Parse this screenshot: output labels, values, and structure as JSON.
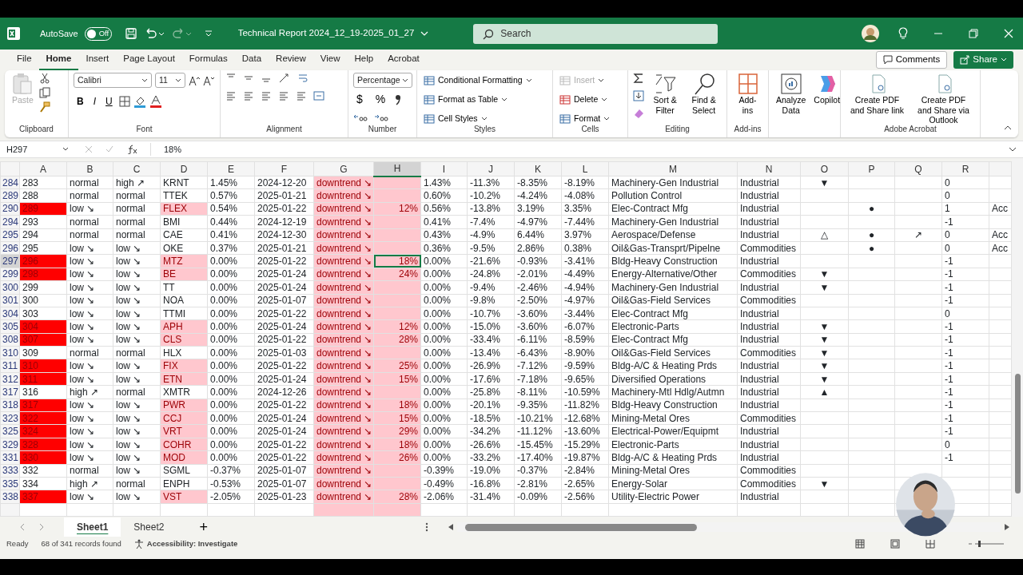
{
  "titlebar": {
    "autosave_label": "AutoSave",
    "autosave": {
      "on": false,
      "text": "Off"
    },
    "title": "Technical Report 2024_12_19-2025_01_27",
    "search": {
      "placeholder": "Search"
    }
  },
  "menu": [
    {
      "label": "File",
      "selected": false
    },
    {
      "label": "Home",
      "selected": true
    },
    {
      "label": "Insert",
      "selected": false
    },
    {
      "label": "Page Layout",
      "selected": false
    },
    {
      "label": "Formulas",
      "selected": false
    },
    {
      "label": "Data",
      "selected": false
    },
    {
      "label": "Review",
      "selected": false
    },
    {
      "label": "View",
      "selected": false
    },
    {
      "label": "Help",
      "selected": false
    },
    {
      "label": "Acrobat",
      "selected": false
    }
  ],
  "menu_buttons": [
    "Comments",
    "Share"
  ],
  "ribbon": [
    {
      "label": "Clipboard",
      "items": [
        {
          "kind": "paste",
          "text": "Paste",
          "disabled": true
        }
      ]
    },
    {
      "label": "Font",
      "items": [
        {
          "kind": "select",
          "text": "Calibri",
          "disabled": false
        },
        {
          "kind": "select",
          "text": "11",
          "disabled": false
        },
        {
          "kind": "glyph",
          "text": "B",
          "disabled": false
        },
        {
          "kind": "glyph",
          "text": "I",
          "disabled": false
        },
        {
          "kind": "glyph",
          "text": "U",
          "disabled": false
        }
      ]
    },
    {
      "label": "Alignment"
    },
    {
      "label": "Number",
      "items": [
        {
          "kind": "select",
          "text": "Percentage",
          "disabled": false
        },
        {
          "kind": "glyph",
          "text": "$",
          "disabled": false
        },
        {
          "kind": "glyph",
          "text": "%",
          "disabled": false
        }
      ]
    },
    {
      "label": "Styles",
      "items": [
        {
          "kind": "small",
          "text": "Conditional Formatting",
          "disabled": false
        },
        {
          "kind": "small",
          "text": "Format as Table",
          "disabled": false
        },
        {
          "kind": "small",
          "text": "Cell Styles",
          "disabled": false
        }
      ]
    },
    {
      "label": "Cells",
      "items": [
        {
          "kind": "small",
          "text": "Insert",
          "disabled": true
        },
        {
          "kind": "small",
          "text": "Delete",
          "disabled": false
        },
        {
          "kind": "small",
          "text": "Format",
          "disabled": false
        }
      ]
    },
    {
      "label": "Editing",
      "items": [
        {
          "kind": "big",
          "text": "Sort & Filter",
          "disabled": false
        },
        {
          "kind": "big",
          "text": "Find & Select",
          "disabled": false
        }
      ]
    },
    {
      "label": "Add-ins",
      "items": [
        {
          "kind": "big",
          "text": "Add-ins",
          "disabled": false
        }
      ]
    },
    {
      "items": [
        {
          "kind": "big",
          "text": "Analyze Data",
          "disabled": false
        },
        {
          "kind": "big",
          "text": "Copilot",
          "disabled": false
        }
      ]
    },
    {
      "label": "Adobe Acrobat",
      "items": [
        {
          "kind": "big",
          "text": "Create PDF and Share link",
          "disabled": false
        },
        {
          "kind": "big",
          "text": "Create PDF and Share via Outlook",
          "disabled": false
        }
      ]
    }
  ],
  "formula_bar": {
    "name_box": "H297",
    "formula": "18%"
  },
  "columns": [
    {
      "letter": "A",
      "selected": false,
      "highlight": false
    },
    {
      "letter": "B",
      "selected": false,
      "highlight": false
    },
    {
      "letter": "C",
      "selected": false,
      "highlight": false
    },
    {
      "letter": "D",
      "selected": false,
      "highlight": false
    },
    {
      "letter": "E",
      "selected": false,
      "highlight": false
    },
    {
      "letter": "F",
      "selected": false,
      "highlight": false
    },
    {
      "letter": "G",
      "selected": false,
      "highlight": true
    },
    {
      "letter": "H",
      "selected": true,
      "highlight": true
    },
    {
      "letter": "I",
      "selected": false,
      "highlight": false
    },
    {
      "letter": "J",
      "selected": false,
      "highlight": false
    },
    {
      "letter": "K",
      "selected": false,
      "highlight": false
    },
    {
      "letter": "L",
      "selected": false,
      "highlight": false
    },
    {
      "letter": "M",
      "selected": false,
      "highlight": false
    },
    {
      "letter": "N",
      "selected": false,
      "highlight": false
    },
    {
      "letter": "O",
      "selected": false,
      "highlight": false
    },
    {
      "letter": "P",
      "selected": false,
      "highlight": false
    },
    {
      "letter": "Q",
      "selected": false,
      "highlight": false
    },
    {
      "letter": "R",
      "selected": false,
      "highlight": false
    }
  ],
  "rows": [
    {
      "row": "284",
      "flagged": false,
      "selected": false,
      "cells": [
        "283",
        "normal",
        "high ↗",
        "KRNT",
        "1.45%",
        "2024-12-20",
        "downtrend ↘",
        "",
        "1.43%",
        "-11.3%",
        "-8.35%",
        "-8.19%",
        "Machinery-Gen Industrial",
        "Industrial",
        "▼",
        "",
        "",
        "0",
        ""
      ]
    },
    {
      "row": "289",
      "flagged": false,
      "selected": false,
      "cells": [
        "288",
        "normal",
        "normal",
        "TTEK",
        "0.57%",
        "2025-01-21",
        "downtrend ↘",
        "",
        "0.60%",
        "-10.2%",
        "-4.24%",
        "-4.08%",
        "Pollution Control",
        "Industrial",
        "",
        "",
        "",
        "0",
        ""
      ]
    },
    {
      "row": "290",
      "flagged": true,
      "selected": false,
      "cells": [
        "289",
        "low ↘",
        "normal",
        "FLEX",
        "0.54%",
        "2025-01-22",
        "downtrend ↘",
        "12%",
        "0.56%",
        "-13.8%",
        "3.19%",
        "3.35%",
        "Elec-Contract Mfg",
        "Industrial",
        "",
        "●",
        "",
        "1",
        "Acc"
      ]
    },
    {
      "row": "294",
      "flagged": false,
      "selected": false,
      "cells": [
        "293",
        "normal",
        "normal",
        "BMI",
        "0.44%",
        "2024-12-19",
        "downtrend ↘",
        "",
        "0.41%",
        "-7.4%",
        "-4.97%",
        "-7.44%",
        "Machinery-Gen Industrial",
        "Industrial",
        "",
        "",
        "",
        "-1",
        ""
      ]
    },
    {
      "row": "295",
      "flagged": false,
      "selected": false,
      "cells": [
        "294",
        "normal",
        "normal",
        "CAE",
        "0.41%",
        "2024-12-30",
        "downtrend ↘",
        "",
        "0.43%",
        "-4.9%",
        "6.44%",
        "3.97%",
        "Aerospace/Defense",
        "Industrial",
        "△",
        "●",
        "↗",
        "0",
        "Acc"
      ]
    },
    {
      "row": "296",
      "flagged": false,
      "selected": false,
      "cells": [
        "295",
        "low ↘",
        "low ↘",
        "OKE",
        "0.37%",
        "2025-01-21",
        "downtrend ↘",
        "",
        "0.36%",
        "-9.5%",
        "2.86%",
        "0.38%",
        "Oil&Gas-Transprt/Pipelne",
        "Commodities",
        "",
        "●",
        "",
        "0",
        "Acc"
      ]
    },
    {
      "row": "297",
      "flagged": true,
      "selected": true,
      "cells": [
        "296",
        "low ↘",
        "low ↘",
        "MTZ",
        "0.00%",
        "2025-01-22",
        "downtrend ↘",
        "18%",
        "0.00%",
        "-21.6%",
        "-0.93%",
        "-3.41%",
        "Bldg-Heavy Construction",
        "Industrial",
        "",
        "",
        "",
        "-1",
        ""
      ]
    },
    {
      "row": "299",
      "flagged": true,
      "selected": false,
      "cells": [
        "298",
        "low ↘",
        "low ↘",
        "BE",
        "0.00%",
        "2025-01-24",
        "downtrend ↘",
        "24%",
        "0.00%",
        "-24.8%",
        "-2.01%",
        "-4.49%",
        "Energy-Alternative/Other",
        "Commodities",
        "▼",
        "",
        "",
        "-1",
        ""
      ]
    },
    {
      "row": "300",
      "flagged": false,
      "selected": false,
      "cells": [
        "299",
        "low ↘",
        "low ↘",
        "TT",
        "0.00%",
        "2025-01-24",
        "downtrend ↘",
        "",
        "0.00%",
        "-9.4%",
        "-2.46%",
        "-4.94%",
        "Machinery-Gen Industrial",
        "Industrial",
        "▼",
        "",
        "",
        "-1",
        ""
      ]
    },
    {
      "row": "301",
      "flagged": false,
      "selected": false,
      "cells": [
        "300",
        "low ↘",
        "low ↘",
        "NOA",
        "0.00%",
        "2025-01-07",
        "downtrend ↘",
        "",
        "0.00%",
        "-9.8%",
        "-2.50%",
        "-4.97%",
        "Oil&Gas-Field Services",
        "Commodities",
        "",
        "",
        "",
        "-1",
        ""
      ]
    },
    {
      "row": "304",
      "flagged": false,
      "selected": false,
      "cells": [
        "303",
        "low ↘",
        "low ↘",
        "TTMI",
        "0.00%",
        "2025-01-22",
        "downtrend ↘",
        "",
        "0.00%",
        "-10.7%",
        "-3.60%",
        "-3.44%",
        "Elec-Contract Mfg",
        "Industrial",
        "",
        "",
        "",
        "0",
        ""
      ]
    },
    {
      "row": "305",
      "flagged": true,
      "selected": false,
      "cells": [
        "304",
        "low ↘",
        "low ↘",
        "APH",
        "0.00%",
        "2025-01-24",
        "downtrend ↘",
        "12%",
        "0.00%",
        "-15.0%",
        "-3.60%",
        "-6.07%",
        "Electronic-Parts",
        "Industrial",
        "▼",
        "",
        "",
        "-1",
        ""
      ]
    },
    {
      "row": "308",
      "flagged": true,
      "selected": false,
      "cells": [
        "307",
        "low ↘",
        "low ↘",
        "CLS",
        "0.00%",
        "2025-01-22",
        "downtrend ↘",
        "28%",
        "0.00%",
        "-33.4%",
        "-6.11%",
        "-8.59%",
        "Elec-Contract Mfg",
        "Industrial",
        "▼",
        "",
        "",
        "-1",
        ""
      ]
    },
    {
      "row": "310",
      "flagged": false,
      "selected": false,
      "cells": [
        "309",
        "normal",
        "normal",
        "HLX",
        "0.00%",
        "2025-01-03",
        "downtrend ↘",
        "",
        "0.00%",
        "-13.4%",
        "-6.43%",
        "-8.90%",
        "Oil&Gas-Field Services",
        "Commodities",
        "▼",
        "",
        "",
        "-1",
        ""
      ]
    },
    {
      "row": "311",
      "flagged": true,
      "selected": false,
      "cells": [
        "310",
        "low ↘",
        "low ↘",
        "FIX",
        "0.00%",
        "2025-01-22",
        "downtrend ↘",
        "25%",
        "0.00%",
        "-26.9%",
        "-7.12%",
        "-9.59%",
        "Bldg-A/C & Heating Prds",
        "Industrial",
        "▼",
        "",
        "",
        "-1",
        ""
      ]
    },
    {
      "row": "312",
      "flagged": true,
      "selected": false,
      "cells": [
        "311",
        "low ↘",
        "low ↘",
        "ETN",
        "0.00%",
        "2025-01-24",
        "downtrend ↘",
        "15%",
        "0.00%",
        "-17.6%",
        "-7.18%",
        "-9.65%",
        "Diversified Operations",
        "Industrial",
        "▼",
        "",
        "",
        "-1",
        ""
      ]
    },
    {
      "row": "317",
      "flagged": false,
      "selected": false,
      "cells": [
        "316",
        "high ↗",
        "normal",
        "XMTR",
        "0.00%",
        "2024-12-26",
        "downtrend ↘",
        "",
        "0.00%",
        "-25.8%",
        "-8.11%",
        "-10.59%",
        "Machinery-Mtl Hdlg/Autmn",
        "Industrial",
        "▲",
        "",
        "",
        "-1",
        ""
      ]
    },
    {
      "row": "318",
      "flagged": true,
      "selected": false,
      "cells": [
        "317",
        "low ↘",
        "low ↘",
        "PWR",
        "0.00%",
        "2025-01-22",
        "downtrend ↘",
        "18%",
        "0.00%",
        "-20.1%",
        "-9.35%",
        "-11.82%",
        "Bldg-Heavy Construction",
        "Industrial",
        "",
        "",
        "",
        "-1",
        ""
      ]
    },
    {
      "row": "323",
      "flagged": true,
      "selected": false,
      "cells": [
        "322",
        "low ↘",
        "low ↘",
        "CCJ",
        "0.00%",
        "2025-01-24",
        "downtrend ↘",
        "15%",
        "0.00%",
        "-18.5%",
        "-10.21%",
        "-12.68%",
        "Mining-Metal Ores",
        "Commodities",
        "",
        "",
        "",
        "-1",
        ""
      ]
    },
    {
      "row": "325",
      "flagged": true,
      "selected": false,
      "cells": [
        "324",
        "low ↘",
        "low ↘",
        "VRT",
        "0.00%",
        "2025-01-24",
        "downtrend ↘",
        "29%",
        "0.00%",
        "-34.2%",
        "-11.12%",
        "-13.60%",
        "Electrical-Power/Equipmt",
        "Industrial",
        "",
        "",
        "",
        "-1",
        ""
      ]
    },
    {
      "row": "329",
      "flagged": true,
      "selected": false,
      "cells": [
        "328",
        "low ↘",
        "low ↘",
        "COHR",
        "0.00%",
        "2025-01-22",
        "downtrend ↘",
        "18%",
        "0.00%",
        "-26.6%",
        "-15.45%",
        "-15.29%",
        "Electronic-Parts",
        "Industrial",
        "",
        "",
        "",
        "0",
        ""
      ]
    },
    {
      "row": "331",
      "flagged": true,
      "selected": false,
      "cells": [
        "330",
        "low ↘",
        "low ↘",
        "MOD",
        "0.00%",
        "2025-01-22",
        "downtrend ↘",
        "26%",
        "0.00%",
        "-33.2%",
        "-17.40%",
        "-19.87%",
        "Bldg-A/C & Heating Prds",
        "Industrial",
        "",
        "",
        "",
        "-1",
        ""
      ]
    },
    {
      "row": "333",
      "flagged": false,
      "selected": false,
      "cells": [
        "332",
        "normal",
        "low ↘",
        "SGML",
        "-0.37%",
        "2025-01-07",
        "downtrend ↘",
        "",
        "-0.39%",
        "-19.0%",
        "-0.37%",
        "-2.84%",
        "Mining-Metal Ores",
        "Commodities",
        "",
        "",
        "",
        "",
        ""
      ]
    },
    {
      "row": "335",
      "flagged": false,
      "selected": false,
      "cells": [
        "334",
        "high ↗",
        "normal",
        "ENPH",
        "-0.53%",
        "2025-01-07",
        "downtrend ↘",
        "",
        "-0.49%",
        "-16.8%",
        "-2.81%",
        "-2.65%",
        "Energy-Solar",
        "Commodities",
        "▼",
        "",
        "",
        "",
        ""
      ]
    },
    {
      "row": "338",
      "flagged": true,
      "selected": false,
      "cells": [
        "337",
        "low ↘",
        "low ↘",
        "VST",
        "-2.05%",
        "2025-01-23",
        "downtrend ↘",
        "28%",
        "-2.06%",
        "-31.4%",
        "-0.09%",
        "-2.56%",
        "Utility-Electric Power",
        "Industrial",
        "",
        "",
        "",
        "",
        ""
      ]
    }
  ],
  "sheets": [
    {
      "label": "Sheet1",
      "selected": true
    },
    {
      "label": "Sheet2",
      "selected": false
    }
  ],
  "add_sheet": "+",
  "status_bar": {
    "mode": "Ready",
    "records": "68 of 341 records found",
    "accessibility": "Accessibility: Investigate"
  },
  "webcam": {
    "kind": "picture"
  }
}
